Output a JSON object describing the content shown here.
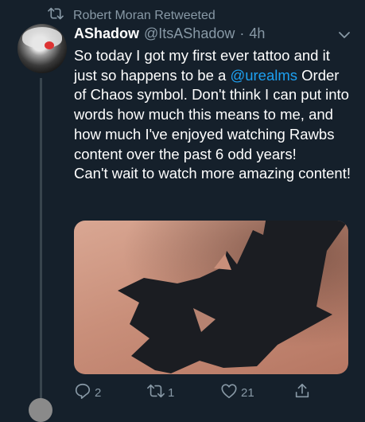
{
  "retweet": {
    "label": "Robert Moran Retweeted"
  },
  "tweet": {
    "display_name": "AShadow",
    "handle": "@ItsAShadow",
    "separator": "·",
    "time": "4h",
    "text_before": "So today I got my first ever tattoo and it just so happens to be a ",
    "mention": "@urealms",
    "text_after": " Order of Chaos symbol. Don't think I can put into words how much this means to me, and how much I've enjoyed watching Rawbs content over the past 6 odd years!\nCan't wait to watch more amazing content!"
  },
  "actions": {
    "replies": "2",
    "retweets": "1",
    "likes": "21"
  },
  "icons": {
    "retweet": "retweet-icon",
    "chevron": "chevron-down-icon",
    "reply": "reply-icon",
    "like": "heart-icon",
    "share": "share-icon"
  },
  "colors": {
    "background": "#15202b",
    "secondary_text": "#8899a6",
    "link": "#1da1f2",
    "tattoo_ink": "#1b1d22"
  }
}
